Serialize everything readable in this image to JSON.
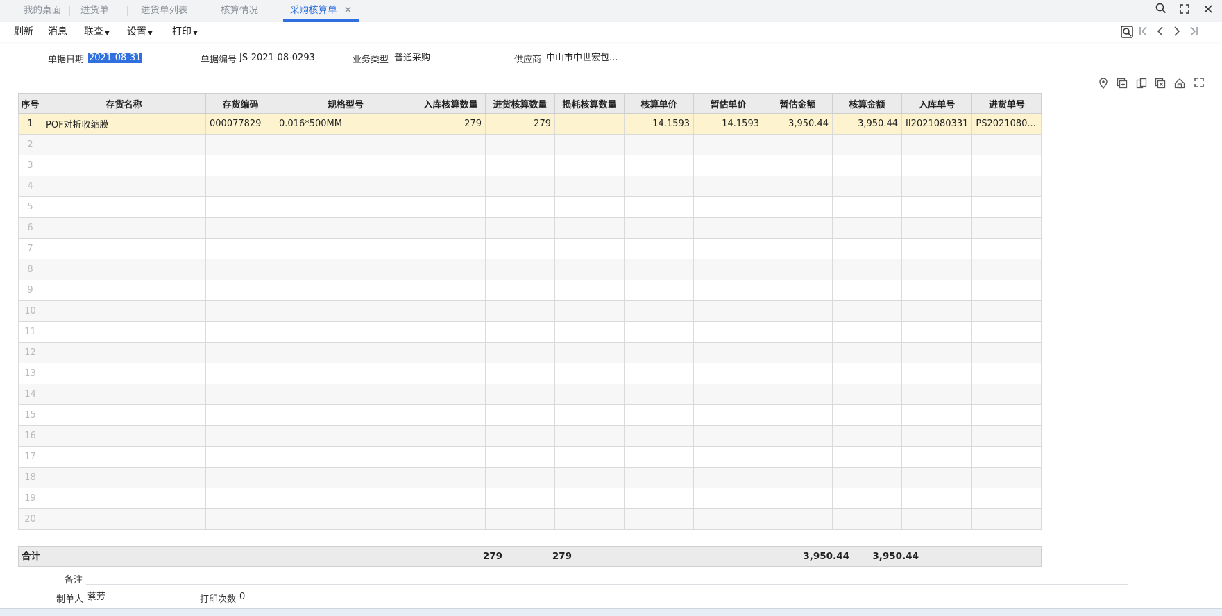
{
  "tabs": [
    {
      "label": "我的桌面"
    },
    {
      "label": "进货单"
    },
    {
      "label": "进货单列表"
    },
    {
      "label": "核算情况"
    },
    {
      "label": "采购核算单",
      "active": true
    }
  ],
  "toolbar": {
    "refresh": "刷新",
    "message": "消息",
    "linked_query": "联查",
    "settings": "设置",
    "print": "打印"
  },
  "header": {
    "date_label": "单据日期",
    "date_value": "2021-08-31",
    "number_label": "单据编号",
    "number_value": "JS-2021-08-0293",
    "biz_type_label": "业务类型",
    "biz_type_value": "普通采购",
    "supplier_label": "供应商",
    "supplier_value": "中山市中世宏包..."
  },
  "grid": {
    "columns": [
      "序号",
      "存货名称",
      "存货编码",
      "规格型号",
      "入库核算数量",
      "进货核算数量",
      "损耗核算数量",
      "核算单价",
      "暂估单价",
      "暂估金额",
      "核算金额",
      "入库单号",
      "进货单号"
    ],
    "rows": [
      [
        "1",
        "POF对折收缩膜",
        "000077829",
        "0.016*500MM",
        "279",
        "279",
        "",
        "14.1593",
        "14.1593",
        "3,950.44",
        "3,950.44",
        "II2021080331",
        "PS2021080..."
      ],
      [
        "2",
        "",
        "",
        "",
        "",
        "",
        "",
        "",
        "",
        "",
        "",
        "",
        ""
      ],
      [
        "3",
        "",
        "",
        "",
        "",
        "",
        "",
        "",
        "",
        "",
        "",
        "",
        ""
      ],
      [
        "4",
        "",
        "",
        "",
        "",
        "",
        "",
        "",
        "",
        "",
        "",
        "",
        ""
      ],
      [
        "5",
        "",
        "",
        "",
        "",
        "",
        "",
        "",
        "",
        "",
        "",
        "",
        ""
      ],
      [
        "6",
        "",
        "",
        "",
        "",
        "",
        "",
        "",
        "",
        "",
        "",
        "",
        ""
      ],
      [
        "7",
        "",
        "",
        "",
        "",
        "",
        "",
        "",
        "",
        "",
        "",
        "",
        ""
      ],
      [
        "8",
        "",
        "",
        "",
        "",
        "",
        "",
        "",
        "",
        "",
        "",
        "",
        ""
      ],
      [
        "9",
        "",
        "",
        "",
        "",
        "",
        "",
        "",
        "",
        "",
        "",
        "",
        ""
      ],
      [
        "10",
        "",
        "",
        "",
        "",
        "",
        "",
        "",
        "",
        "",
        "",
        "",
        ""
      ],
      [
        "11",
        "",
        "",
        "",
        "",
        "",
        "",
        "",
        "",
        "",
        "",
        "",
        ""
      ],
      [
        "12",
        "",
        "",
        "",
        "",
        "",
        "",
        "",
        "",
        "",
        "",
        "",
        ""
      ],
      [
        "13",
        "",
        "",
        "",
        "",
        "",
        "",
        "",
        "",
        "",
        "",
        "",
        ""
      ],
      [
        "14",
        "",
        "",
        "",
        "",
        "",
        "",
        "",
        "",
        "",
        "",
        "",
        ""
      ],
      [
        "15",
        "",
        "",
        "",
        "",
        "",
        "",
        "",
        "",
        "",
        "",
        "",
        ""
      ],
      [
        "16",
        "",
        "",
        "",
        "",
        "",
        "",
        "",
        "",
        "",
        "",
        "",
        ""
      ],
      [
        "17",
        "",
        "",
        "",
        "",
        "",
        "",
        "",
        "",
        "",
        "",
        "",
        ""
      ],
      [
        "18",
        "",
        "",
        "",
        "",
        "",
        "",
        "",
        "",
        "",
        "",
        "",
        ""
      ],
      [
        "19",
        "",
        "",
        "",
        "",
        "",
        "",
        "",
        "",
        "",
        "",
        "",
        ""
      ],
      [
        "20",
        "",
        "",
        "",
        "",
        "",
        "",
        "",
        "",
        "",
        "",
        "",
        ""
      ]
    ]
  },
  "totals": {
    "label": "合计",
    "in_qty": "279",
    "purchase_qty": "279",
    "est_amount": "3,950.44",
    "acct_amount": "3,950.44"
  },
  "footer": {
    "remark_label": "备注",
    "remark_value": "",
    "maker_label": "制单人",
    "maker_value": "蔡芳",
    "print_count_label": "打印次数",
    "print_count_value": "0"
  },
  "colors": {
    "accent": "#2f6fde",
    "highlight_row": "#fdf4cf",
    "header_bg": "#ebebeb"
  },
  "icons": {
    "window": [
      "search-icon",
      "fullscreen-icon",
      "close-icon"
    ],
    "nav": [
      "find-icon",
      "first-page-icon",
      "prev-page-icon",
      "next-page-icon",
      "last-page-icon"
    ],
    "grid_tools": [
      "location-icon",
      "add-row-icon",
      "copy-row-icon",
      "delete-row-icon",
      "home-icon",
      "expand-icon"
    ]
  }
}
